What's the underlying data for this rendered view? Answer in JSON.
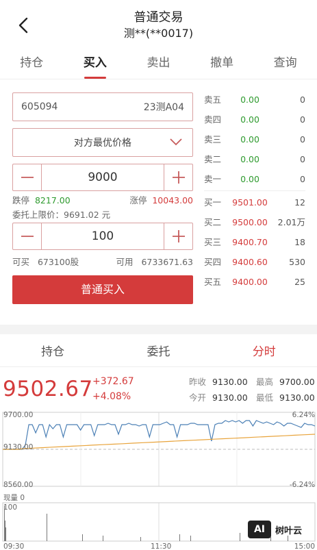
{
  "header": {
    "title": "普通交易",
    "subtitle": "测**(**0017)"
  },
  "tabs": [
    "持仓",
    "买入",
    "卖出",
    "撤单",
    "查询"
  ],
  "form": {
    "stock_code": "605094",
    "stock_name": "23测A04",
    "price_type": "对方最优价格",
    "price_value": "9000",
    "limit_down_label": "跌停",
    "limit_down_value": "8217.00",
    "limit_up_label": "涨停",
    "limit_up_value": "10043.00",
    "upper_limit_text": "委托上限价：9691.02 元",
    "quantity_value": "100",
    "can_buy_label": "可买",
    "can_buy_value": "673100股",
    "available_label": "可用",
    "available_value": "6733671.63",
    "buy_button": "普通买入"
  },
  "order_book": {
    "sell": [
      {
        "label": "卖五",
        "price": "0.00",
        "volume": "0"
      },
      {
        "label": "卖四",
        "price": "0.00",
        "volume": "0"
      },
      {
        "label": "卖三",
        "price": "0.00",
        "volume": "0"
      },
      {
        "label": "卖二",
        "price": "0.00",
        "volume": "0"
      },
      {
        "label": "卖一",
        "price": "0.00",
        "volume": "0"
      }
    ],
    "buy": [
      {
        "label": "买一",
        "price": "9501.00",
        "volume": "12"
      },
      {
        "label": "买二",
        "price": "9500.00",
        "volume": "2.01万"
      },
      {
        "label": "买三",
        "price": "9400.70",
        "volume": "18"
      },
      {
        "label": "买四",
        "price": "9400.60",
        "volume": "530"
      },
      {
        "label": "买五",
        "price": "9400.00",
        "volume": "25"
      }
    ]
  },
  "lower_tabs": [
    "持仓",
    "委托",
    "分时"
  ],
  "quote": {
    "price": "9502.67",
    "change": "+372.67",
    "change_pct": "+4.08%",
    "prev_close_label": "昨收",
    "prev_close": "9130.00",
    "high_label": "最高",
    "high": "9700.00",
    "open_label": "今开",
    "open": "9130.00",
    "low_label": "最低",
    "low": "9130.00"
  },
  "chart": {
    "y_top": "9700.00",
    "y_mid": "9130.00",
    "y_bottom": "8560.00",
    "pct_top": "6.24%",
    "pct_bottom": "-6.24%",
    "volume_label": "现量 0",
    "volume_axis": "100",
    "time_start": "09:30",
    "time_mid": "11:30",
    "time_end": "15:00"
  },
  "watermark": {
    "logo": "AI",
    "text": "树叶云"
  },
  "colors": {
    "accent": "#d43b3b",
    "green": "#2e9a2e",
    "line_blue": "#4a7fb5",
    "line_orange": "#e8a33a"
  }
}
